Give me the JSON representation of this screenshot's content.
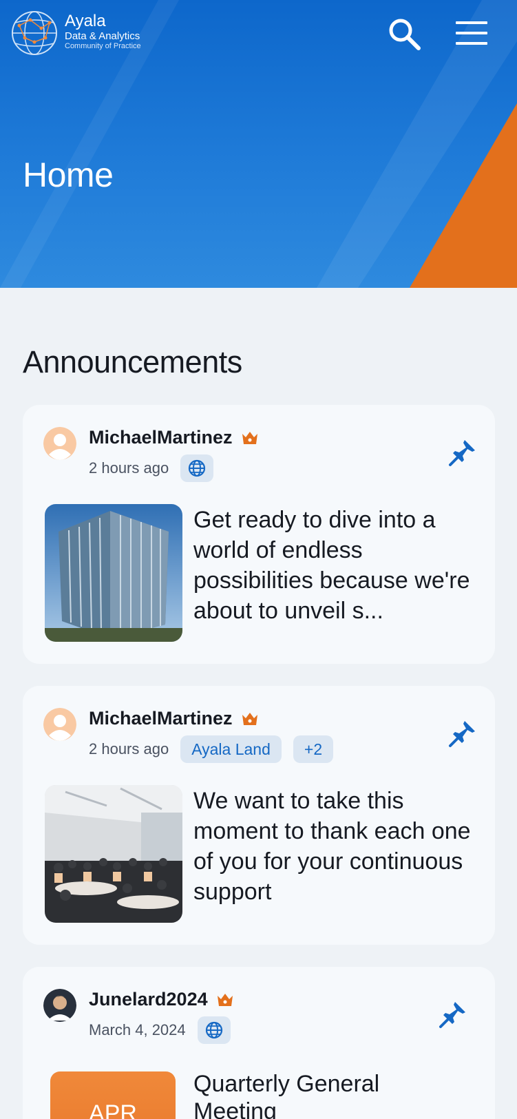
{
  "header": {
    "logo_title": "Ayala",
    "logo_subtitle": "Data & Analytics",
    "logo_tagline": "Community of Practice",
    "page_title": "Home",
    "search_icon": "search-icon",
    "menu_icon": "hamburger-menu-icon"
  },
  "colors": {
    "brand_blue": "#1568c4",
    "accent_orange": "#e3701c",
    "card_bg": "#f6f9fc",
    "page_bg": "#eef2f6"
  },
  "announcements": {
    "title": "Announcements",
    "posts": [
      {
        "author": "MichaelMartinez",
        "time": "2 hours ago",
        "audience_icon": "globe-icon",
        "text": "Get ready to dive into a world of endless possibilities because we're about to unveil s..."
      },
      {
        "author": "MichaelMartinez",
        "time": "2 hours ago",
        "tag": "Ayala Land",
        "tag_more": "+2",
        "text": "We want to take this moment to thank each one of you for your continuous support"
      },
      {
        "author": "Junelard2024",
        "time": "March 4, 2024",
        "audience_icon": "globe-icon",
        "event_month": "APR",
        "text": "Quarterly General Meeting"
      }
    ]
  }
}
